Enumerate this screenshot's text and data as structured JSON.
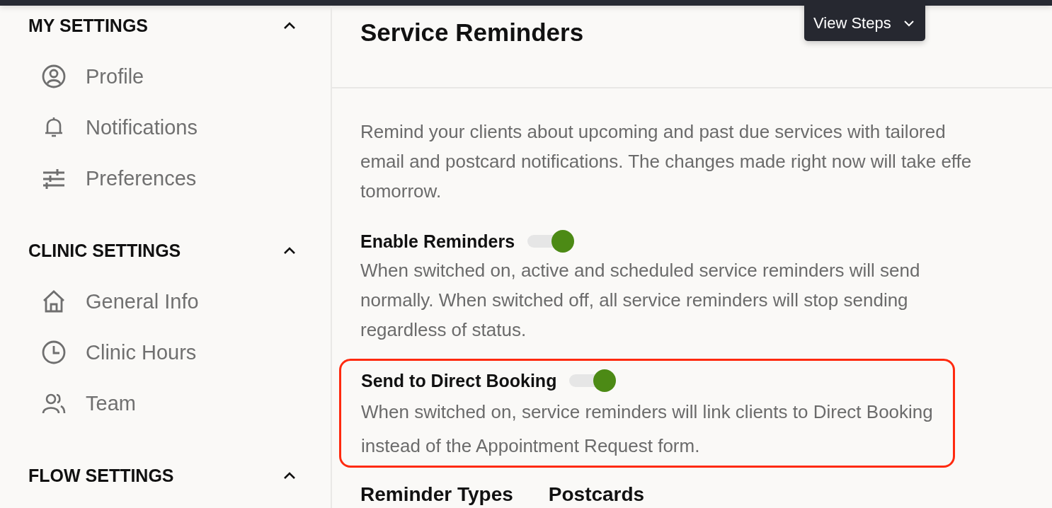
{
  "sidebar": {
    "sections": [
      {
        "title": "MY SETTINGS",
        "expanded": true,
        "items": [
          {
            "label": "Profile"
          },
          {
            "label": "Notifications"
          },
          {
            "label": "Preferences"
          }
        ]
      },
      {
        "title": "CLINIC SETTINGS",
        "expanded": true,
        "items": [
          {
            "label": "General Info"
          },
          {
            "label": "Clinic Hours"
          },
          {
            "label": "Team"
          }
        ]
      },
      {
        "title": "FLOW SETTINGS",
        "expanded": true
      }
    ]
  },
  "header": {
    "title": "Service Reminders",
    "view_steps": "View Steps"
  },
  "description": [
    "Remind your clients about upcoming and past due services with tailored",
    "email and postcard notifications. The changes made right now will take effe",
    "tomorrow."
  ],
  "settings": [
    {
      "label": "Enable Reminders",
      "on": true,
      "highlighted": false,
      "description": [
        "When switched on, active and scheduled service reminders will send",
        "normally. When switched off, all service reminders will stop sending",
        "regardless of status."
      ]
    },
    {
      "label": "Send to Direct Booking",
      "on": true,
      "highlighted": true,
      "description": [
        "When switched on, service reminders will link clients to Direct Booking",
        "instead of the Appointment Request form."
      ]
    }
  ],
  "reminder_types": {
    "title": "Reminder Types",
    "tab": "Postcards"
  }
}
